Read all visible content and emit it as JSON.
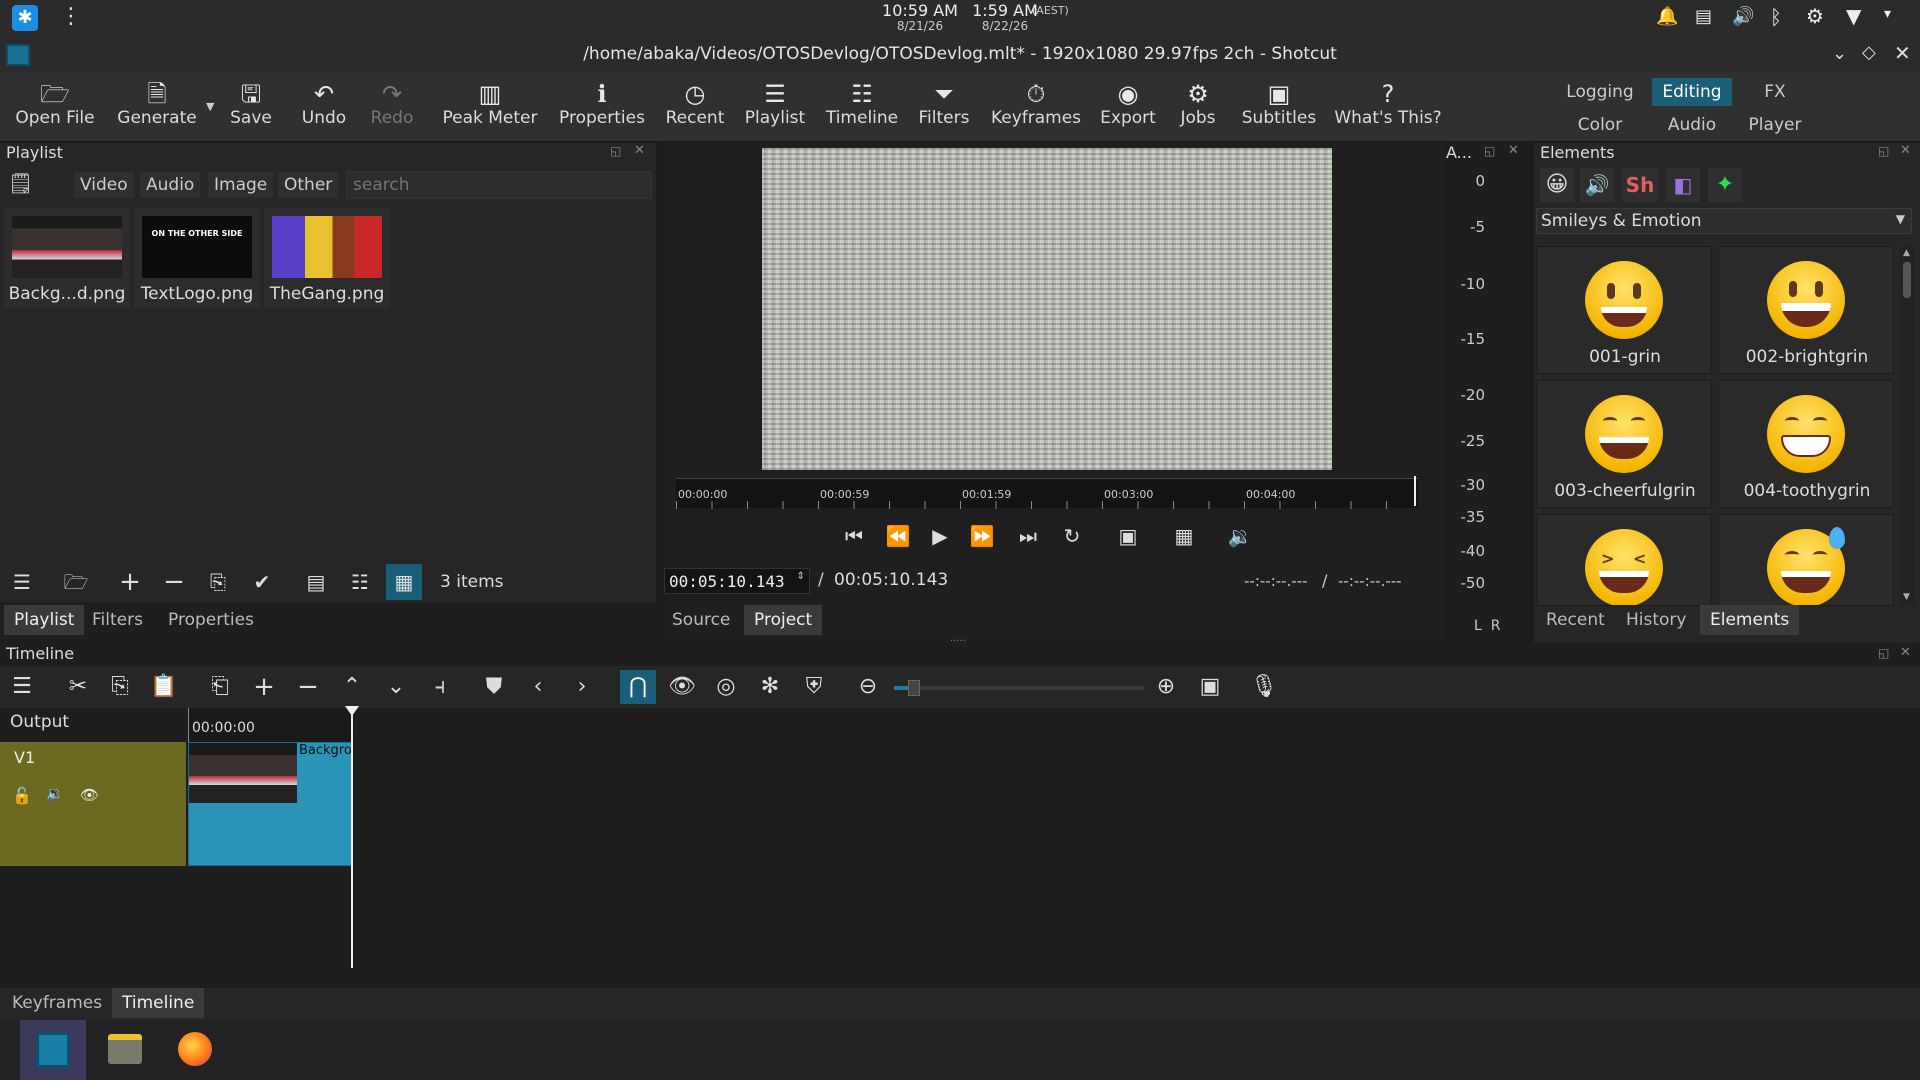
{
  "system": {
    "time1": "10:59 AM",
    "date1": "8/21/26",
    "time2": "1:59 AM",
    "tz": "(AEST)",
    "date2": "8/22/26"
  },
  "window": {
    "title": "/home/abaka/Videos/OTOSDevlog/OTOSDevlog.mlt* - 1920x1080 29.97fps 2ch - Shotcut"
  },
  "toolbar": {
    "items": [
      {
        "label": "Open File",
        "icon": "folder-open-icon"
      },
      {
        "label": "Generate",
        "icon": "generate-icon"
      },
      {
        "label": "Save",
        "icon": "save-icon"
      },
      {
        "label": "Undo",
        "icon": "undo-icon"
      },
      {
        "label": "Redo",
        "icon": "redo-icon"
      },
      {
        "label": "Peak Meter",
        "icon": "peak-meter-icon"
      },
      {
        "label": "Properties",
        "icon": "info-icon"
      },
      {
        "label": "Recent",
        "icon": "clock-icon"
      },
      {
        "label": "Playlist",
        "icon": "list-icon"
      },
      {
        "label": "Timeline",
        "icon": "timeline-icon"
      },
      {
        "label": "Filters",
        "icon": "filter-icon"
      },
      {
        "label": "Keyframes",
        "icon": "stopwatch-icon"
      },
      {
        "label": "Export",
        "icon": "disc-icon"
      },
      {
        "label": "Jobs",
        "icon": "gear-icon"
      },
      {
        "label": "Subtitles",
        "icon": "subtitles-icon"
      },
      {
        "label": "What's This?",
        "icon": "question-icon"
      }
    ],
    "layouts": {
      "logging": "Logging",
      "editing": "Editing",
      "fx": "FX",
      "color": "Color",
      "audio": "Audio",
      "player": "Player"
    }
  },
  "playlist": {
    "title": "Playlist",
    "filters": [
      "Video",
      "Audio",
      "Image",
      "Other"
    ],
    "search_placeholder": "search",
    "items": [
      {
        "label": "Backg...d.png"
      },
      {
        "label": "TextLogo.png"
      },
      {
        "label": "TheGang.png"
      }
    ],
    "count": "3 items",
    "textlogo_text": "ON THE OTHER SIDE"
  },
  "left_tabs": [
    "Playlist",
    "Filters",
    "Properties"
  ],
  "player": {
    "ruler": [
      "00:00:00",
      "00:00:59",
      "00:01:59",
      "00:03:00",
      "00:04:00"
    ],
    "current_time": "00:05:10.143",
    "separator": "/",
    "total_time": "00:05:10.143",
    "in_point": "--:--:--.---",
    "out_point": "--:--:--.---",
    "tabs": [
      "Source",
      "Project"
    ]
  },
  "audio_meter": {
    "title": "A...",
    "scale": [
      "0",
      "-5",
      "-10",
      "-15",
      "-20",
      "-25",
      "-30",
      "-35",
      "-40",
      "-50"
    ],
    "channels": "L  R"
  },
  "elements": {
    "title": "Elements",
    "category": "Smileys & Emotion",
    "items": [
      {
        "label": "001-grin"
      },
      {
        "label": "002-brightgrin"
      },
      {
        "label": "003-cheerfulgrin"
      },
      {
        "label": "004-toothygrin"
      }
    ],
    "tabs": [
      "Recent",
      "History",
      "Elements"
    ],
    "filter_icons": [
      "emoji-icon",
      "speaker-icon",
      "sh-icon",
      "panel-icon",
      "sparkle-icon"
    ],
    "sh_text": "Sh"
  },
  "timeline": {
    "title": "Timeline",
    "output_label": "Output",
    "track_label": "V1",
    "time_marker": "00:00:00",
    "clip_label": "Backgro"
  },
  "bottom_tabs": [
    "Keyframes",
    "Timeline"
  ],
  "colors": {
    "accent": "#1a7fa8",
    "track_header": "#6b6a20",
    "clip": "#2a94b8"
  }
}
